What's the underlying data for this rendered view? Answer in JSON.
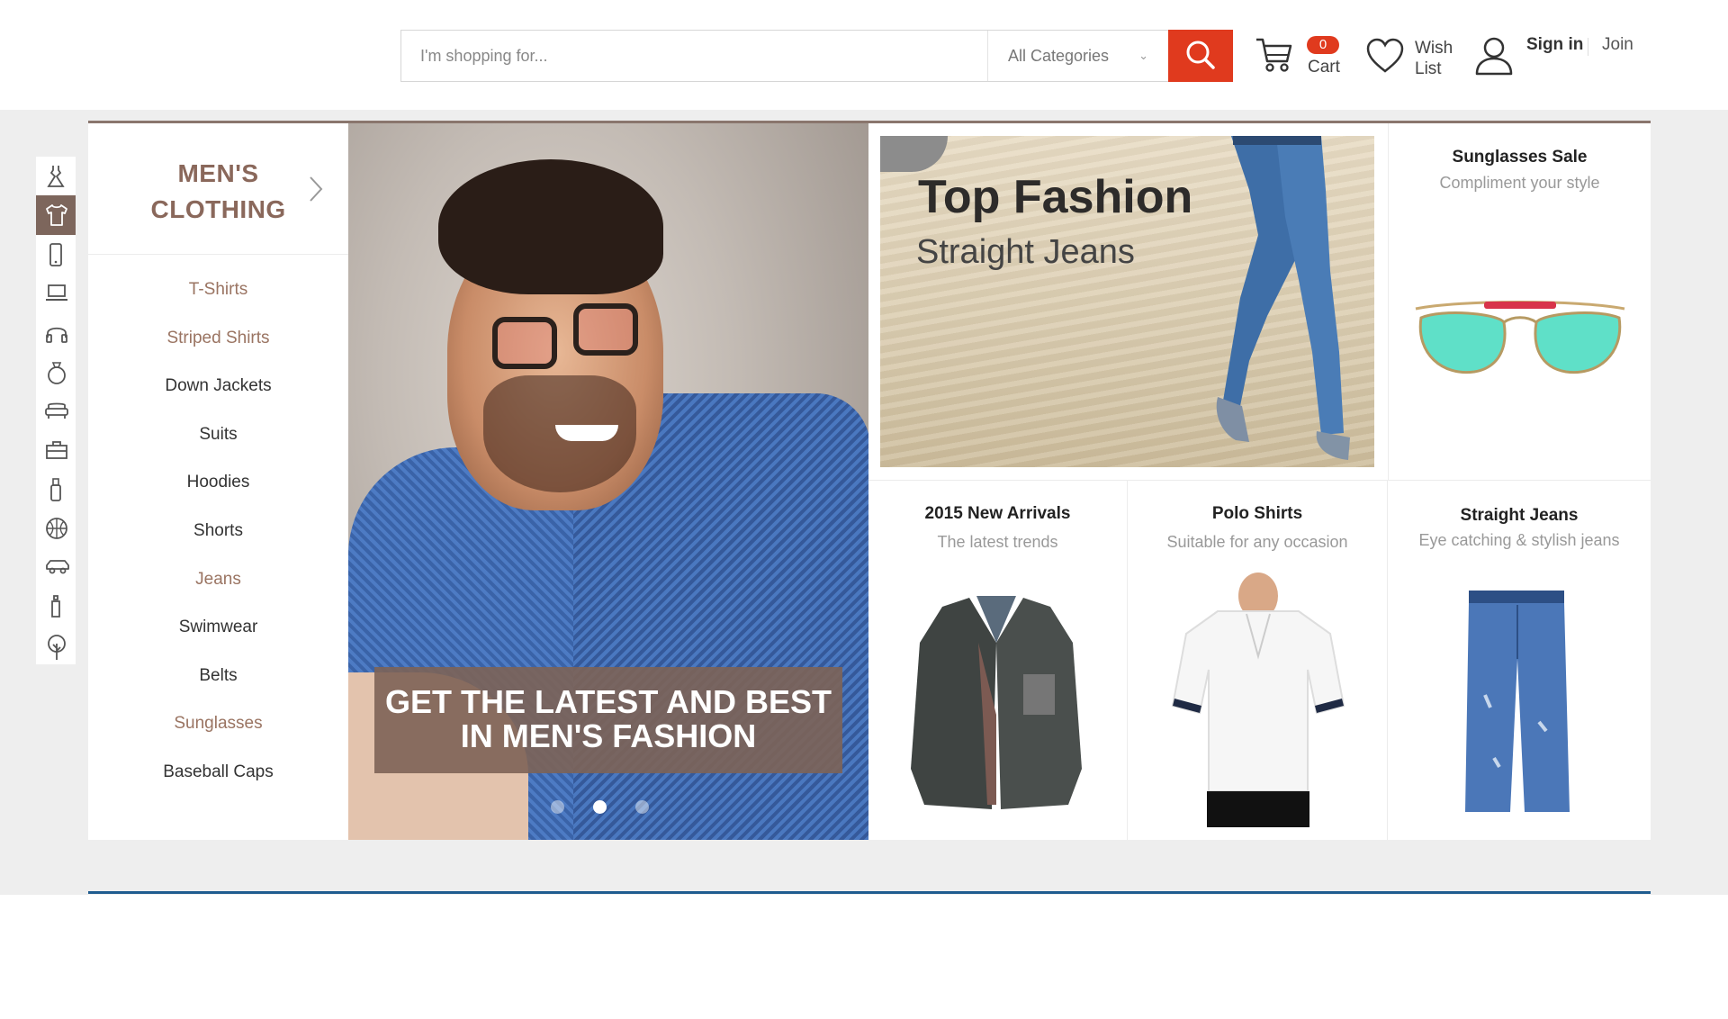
{
  "header": {
    "search": {
      "placeholder": "I'm shopping for...",
      "value": ""
    },
    "category_select": {
      "selected": "All Categories"
    },
    "cart": {
      "count": "0",
      "label": "Cart"
    },
    "wishlist": {
      "label": "Wish List"
    },
    "signin_label": "Sign in",
    "join_label": "Join"
  },
  "icon_sidebar": {
    "items": [
      {
        "icon": "dress-icon",
        "active": false
      },
      {
        "icon": "tshirt-icon",
        "active": true
      },
      {
        "icon": "phone-icon",
        "active": false
      },
      {
        "icon": "laptop-icon",
        "active": false
      },
      {
        "icon": "headphones-icon",
        "active": false
      },
      {
        "icon": "ring-icon",
        "active": false
      },
      {
        "icon": "sofa-icon",
        "active": false
      },
      {
        "icon": "toolbox-icon",
        "active": false
      },
      {
        "icon": "bottle-icon",
        "active": false
      },
      {
        "icon": "basketball-icon",
        "active": false
      },
      {
        "icon": "car-icon",
        "active": false
      },
      {
        "icon": "baby-bottle-icon",
        "active": false
      },
      {
        "icon": "tree-icon",
        "active": false
      }
    ]
  },
  "category_panel": {
    "title": "MEN'S CLOTHING",
    "items": [
      {
        "label": "T-Shirts",
        "accent": true
      },
      {
        "label": "Striped Shirts",
        "accent": true
      },
      {
        "label": "Down Jackets",
        "accent": false
      },
      {
        "label": "Suits",
        "accent": false
      },
      {
        "label": "Hoodies",
        "accent": false
      },
      {
        "label": "Shorts",
        "accent": false
      },
      {
        "label": "Jeans",
        "accent": true
      },
      {
        "label": "Swimwear",
        "accent": false
      },
      {
        "label": "Belts",
        "accent": false
      },
      {
        "label": "Sunglasses",
        "accent": true
      },
      {
        "label": "Baseball Caps",
        "accent": false
      }
    ]
  },
  "hero": {
    "caption": "GET THE LATEST AND BEST IN MEN'S FASHION",
    "slides": 3,
    "active_slide": 2
  },
  "promo": {
    "top_fashion": {
      "title": "Top Fashion",
      "subtitle": "Straight Jeans"
    },
    "sunglasses": {
      "title": "Sunglasses Sale",
      "subtitle": "Compliment your style"
    },
    "new_arrivals": {
      "title": "2015 New Arrivals",
      "subtitle": "The latest trends"
    },
    "polo": {
      "title": "Polo Shirts",
      "subtitle": "Suitable for any occasion"
    },
    "jeans": {
      "title": "Straight Jeans",
      "subtitle": "Eye catching & stylish jeans"
    }
  },
  "colors": {
    "accent_red": "#e03a1e",
    "brown": "#7d665c",
    "category_title": "#8a685b",
    "bottom_line": "#1f5c8f"
  }
}
